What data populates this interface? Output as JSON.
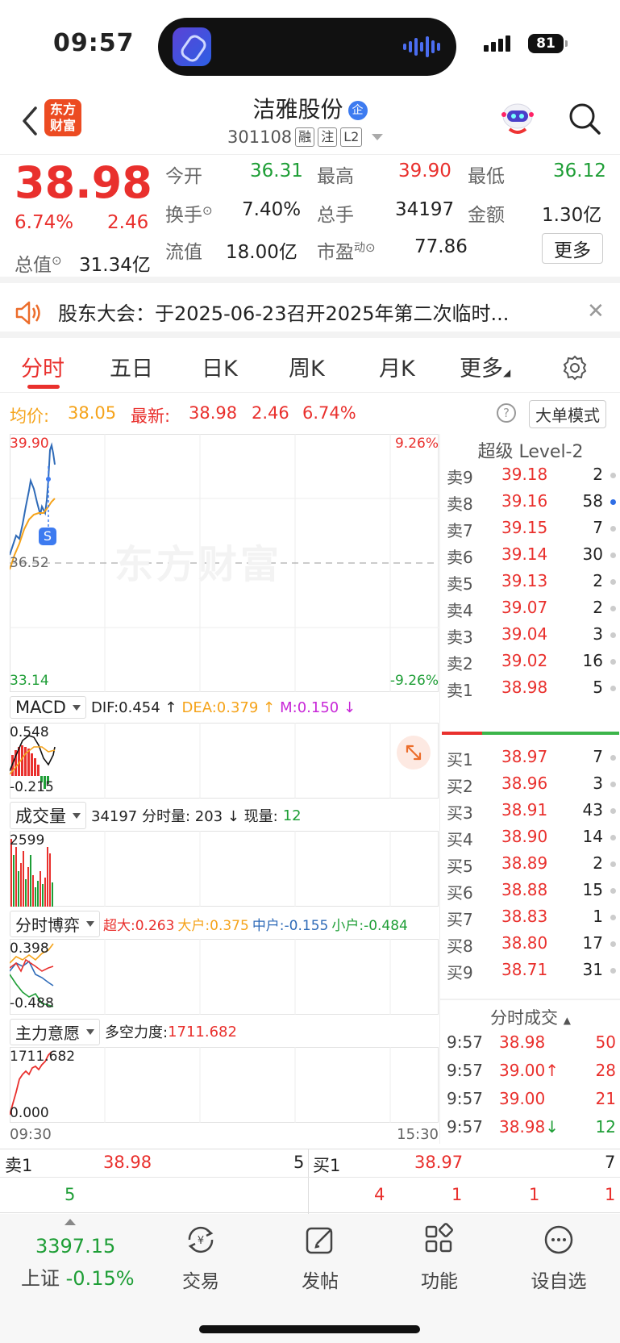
{
  "status_bar": {
    "time": "09:57",
    "battery": "81"
  },
  "header": {
    "logo_line1": "东方",
    "logo_line2": "财富",
    "stock_name": "洁雅股份",
    "stock_badge": "企",
    "stock_code": "301108",
    "tags": [
      "融",
      "注",
      "L2"
    ]
  },
  "quote": {
    "price": "38.98",
    "change_pct": "6.74%",
    "change": "2.46",
    "open_label": "今开",
    "open": "36.31",
    "high_label": "最高",
    "high": "39.90",
    "low_label": "最低",
    "low": "36.12",
    "turnover_label": "换手",
    "turnover": "7.40%",
    "volume_label": "总手",
    "volume": "34197",
    "amount_label": "金额",
    "amount": "1.30亿",
    "mktcap_label": "总值",
    "mktcap": "31.34亿",
    "float_label": "流值",
    "float": "18.00亿",
    "pe_label": "市盈",
    "pe_sup": "动",
    "pe": "77.86",
    "more_button": "更多"
  },
  "notice": {
    "text": "股东大会：于2025-06-23召开2025年第二次临时..."
  },
  "tabs": [
    "分时",
    "五日",
    "日K",
    "周K",
    "月K",
    "更多"
  ],
  "info_line": {
    "avg_label": "均价:",
    "avg": "38.05",
    "latest_label": "最新:",
    "latest": "38.98",
    "chg": "2.46",
    "pct": "6.74%",
    "help": "?",
    "big_order_button": "大单模式"
  },
  "chart": {
    "price_high": "39.90",
    "pct_high": "9.26%",
    "price_mid": "36.52",
    "price_low": "33.14",
    "pct_low": "-9.26%",
    "s_marker": "S",
    "watermark": "东方财富",
    "macd": {
      "name": "MACD",
      "dif": "DIF:0.454 ↑",
      "dea": "DEA:0.379 ↑",
      "m": "M:0.150 ↓",
      "top": "0.548",
      "bottom": "-0.215"
    },
    "volume": {
      "name": "成交量",
      "info1": "34197 分时量: 203 ↓ 现量:",
      "info2": "12",
      "top": "2599"
    },
    "game": {
      "name": "分时博弈",
      "super": "超大:0.263",
      "big": "大户:0.375",
      "mid": "中户:-0.155",
      "small": "小户:-0.484",
      "top": "0.398",
      "bottom": "-0.488"
    },
    "force": {
      "name": "主力意愿",
      "label": "多空力度:",
      "value": "1711.682",
      "top": "1711.682",
      "bottom": "0.000"
    },
    "time_start": "09:30",
    "time_end": "15:30"
  },
  "book": {
    "title": "超级 Level-2",
    "asks": [
      {
        "label": "卖9",
        "price": "39.18",
        "vol": "2"
      },
      {
        "label": "卖8",
        "price": "39.16",
        "vol": "58"
      },
      {
        "label": "卖7",
        "price": "39.15",
        "vol": "7"
      },
      {
        "label": "卖6",
        "price": "39.14",
        "vol": "30"
      },
      {
        "label": "卖5",
        "price": "39.13",
        "vol": "2"
      },
      {
        "label": "卖4",
        "price": "39.07",
        "vol": "2"
      },
      {
        "label": "卖3",
        "price": "39.04",
        "vol": "3"
      },
      {
        "label": "卖2",
        "price": "39.02",
        "vol": "16"
      },
      {
        "label": "卖1",
        "price": "38.98",
        "vol": "5"
      }
    ],
    "bids": [
      {
        "label": "买1",
        "price": "38.97",
        "vol": "7"
      },
      {
        "label": "买2",
        "price": "38.96",
        "vol": "3"
      },
      {
        "label": "买3",
        "price": "38.91",
        "vol": "43"
      },
      {
        "label": "买4",
        "price": "38.90",
        "vol": "14"
      },
      {
        "label": "买5",
        "price": "38.89",
        "vol": "2"
      },
      {
        "label": "买6",
        "price": "38.88",
        "vol": "15"
      },
      {
        "label": "买7",
        "price": "38.83",
        "vol": "1"
      },
      {
        "label": "买8",
        "price": "38.80",
        "vol": "17"
      },
      {
        "label": "买9",
        "price": "38.71",
        "vol": "31"
      }
    ],
    "trades_title": "分时成交",
    "trades": [
      {
        "time": "9:57",
        "price": "38.98",
        "vol": "50"
      },
      {
        "time": "9:57",
        "price": "39.00↑",
        "vol": "28"
      },
      {
        "time": "9:57",
        "price": "39.00",
        "vol": "21"
      },
      {
        "time": "9:57",
        "price": "38.98↓",
        "vol": "12"
      }
    ]
  },
  "bidask": {
    "ask_label": "卖1",
    "ask_price": "38.98",
    "ask_vol": "5",
    "ask_detail": "5",
    "bid_label": "买1",
    "bid_price": "38.97",
    "bid_vol": "7",
    "bid_details": [
      "4",
      "1",
      "1",
      "1"
    ]
  },
  "nav": {
    "index_value": "3397.15",
    "index_name": "上证",
    "index_change": "-0.15%",
    "items": [
      "交易",
      "发帖",
      "功能",
      "设自选"
    ]
  },
  "colors": {
    "up": "#e9302d",
    "down": "#1e9e36",
    "avg": "#f5a31a",
    "price_line": "#2f6bb8"
  },
  "icons": [
    "back-icon",
    "search-icon",
    "robot-icon",
    "speaker-icon",
    "close-icon",
    "settings-icon",
    "help-icon",
    "expand-icon",
    "trade-icon",
    "post-icon",
    "function-icon",
    "watchlist-icon"
  ]
}
